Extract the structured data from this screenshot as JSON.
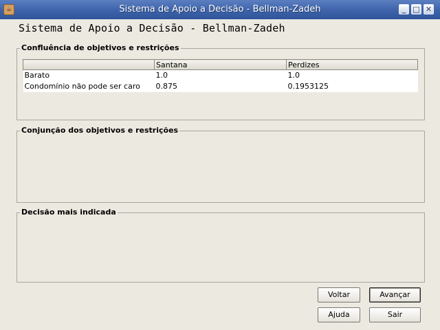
{
  "window": {
    "title": "Sistema de Apoio a Decisão - Bellman-Zadeh",
    "app_icon": "java-cup-icon",
    "controls": {
      "minimize": "_",
      "maximize": "□",
      "close": "✕"
    }
  },
  "heading": "Sistema de Apoio a Decisão - Bellman-Zadeh",
  "confluence": {
    "title": "Confluência de objetivos e restrições",
    "columns": [
      "",
      "Santana",
      "Perdizes"
    ],
    "rows": [
      [
        "Barato",
        "1.0",
        "1.0"
      ],
      [
        "Condomínio não pode ser caro",
        "0.875",
        "0.1953125"
      ]
    ]
  },
  "conjunction": {
    "title": "Conjunção dos objetivos e restrições"
  },
  "decision": {
    "title": "Decisão mais indicada"
  },
  "buttons": {
    "back": "Voltar",
    "next": "Avançar",
    "help": "Ajuda",
    "exit": "Sair"
  }
}
